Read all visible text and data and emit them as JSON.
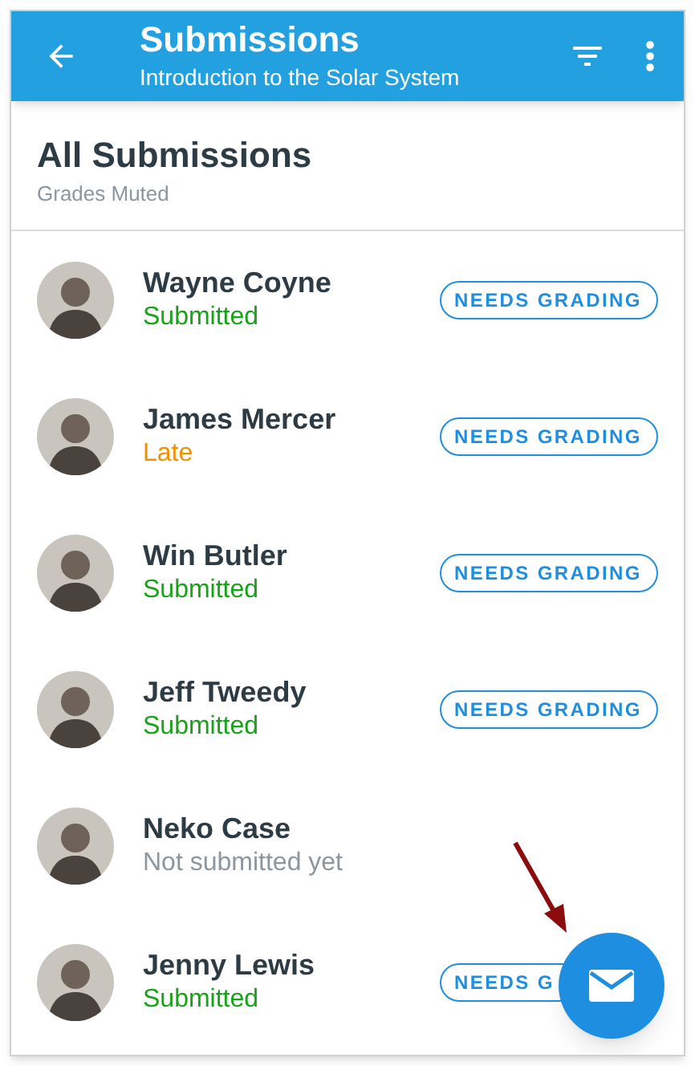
{
  "app_bar": {
    "title": "Submissions",
    "subtitle": "Introduction to the Solar System"
  },
  "header": {
    "title": "All Submissions",
    "subtitle": "Grades Muted"
  },
  "submissions": [
    {
      "name": "Wayne Coyne",
      "status": "Submitted",
      "kind": "submitted",
      "badge": "NEEDS GRADING"
    },
    {
      "name": "James Mercer",
      "status": "Late",
      "kind": "late",
      "badge": "NEEDS GRADING"
    },
    {
      "name": "Win Butler",
      "status": "Submitted",
      "kind": "submitted",
      "badge": "NEEDS GRADING"
    },
    {
      "name": "Jeff Tweedy",
      "status": "Submitted",
      "kind": "submitted",
      "badge": "NEEDS GRADING"
    },
    {
      "name": "Neko Case",
      "status": "Not submitted yet",
      "kind": "missing"
    },
    {
      "name": "Jenny Lewis",
      "status": "Submitted",
      "kind": "submitted",
      "badge": "NEEDS G"
    }
  ]
}
